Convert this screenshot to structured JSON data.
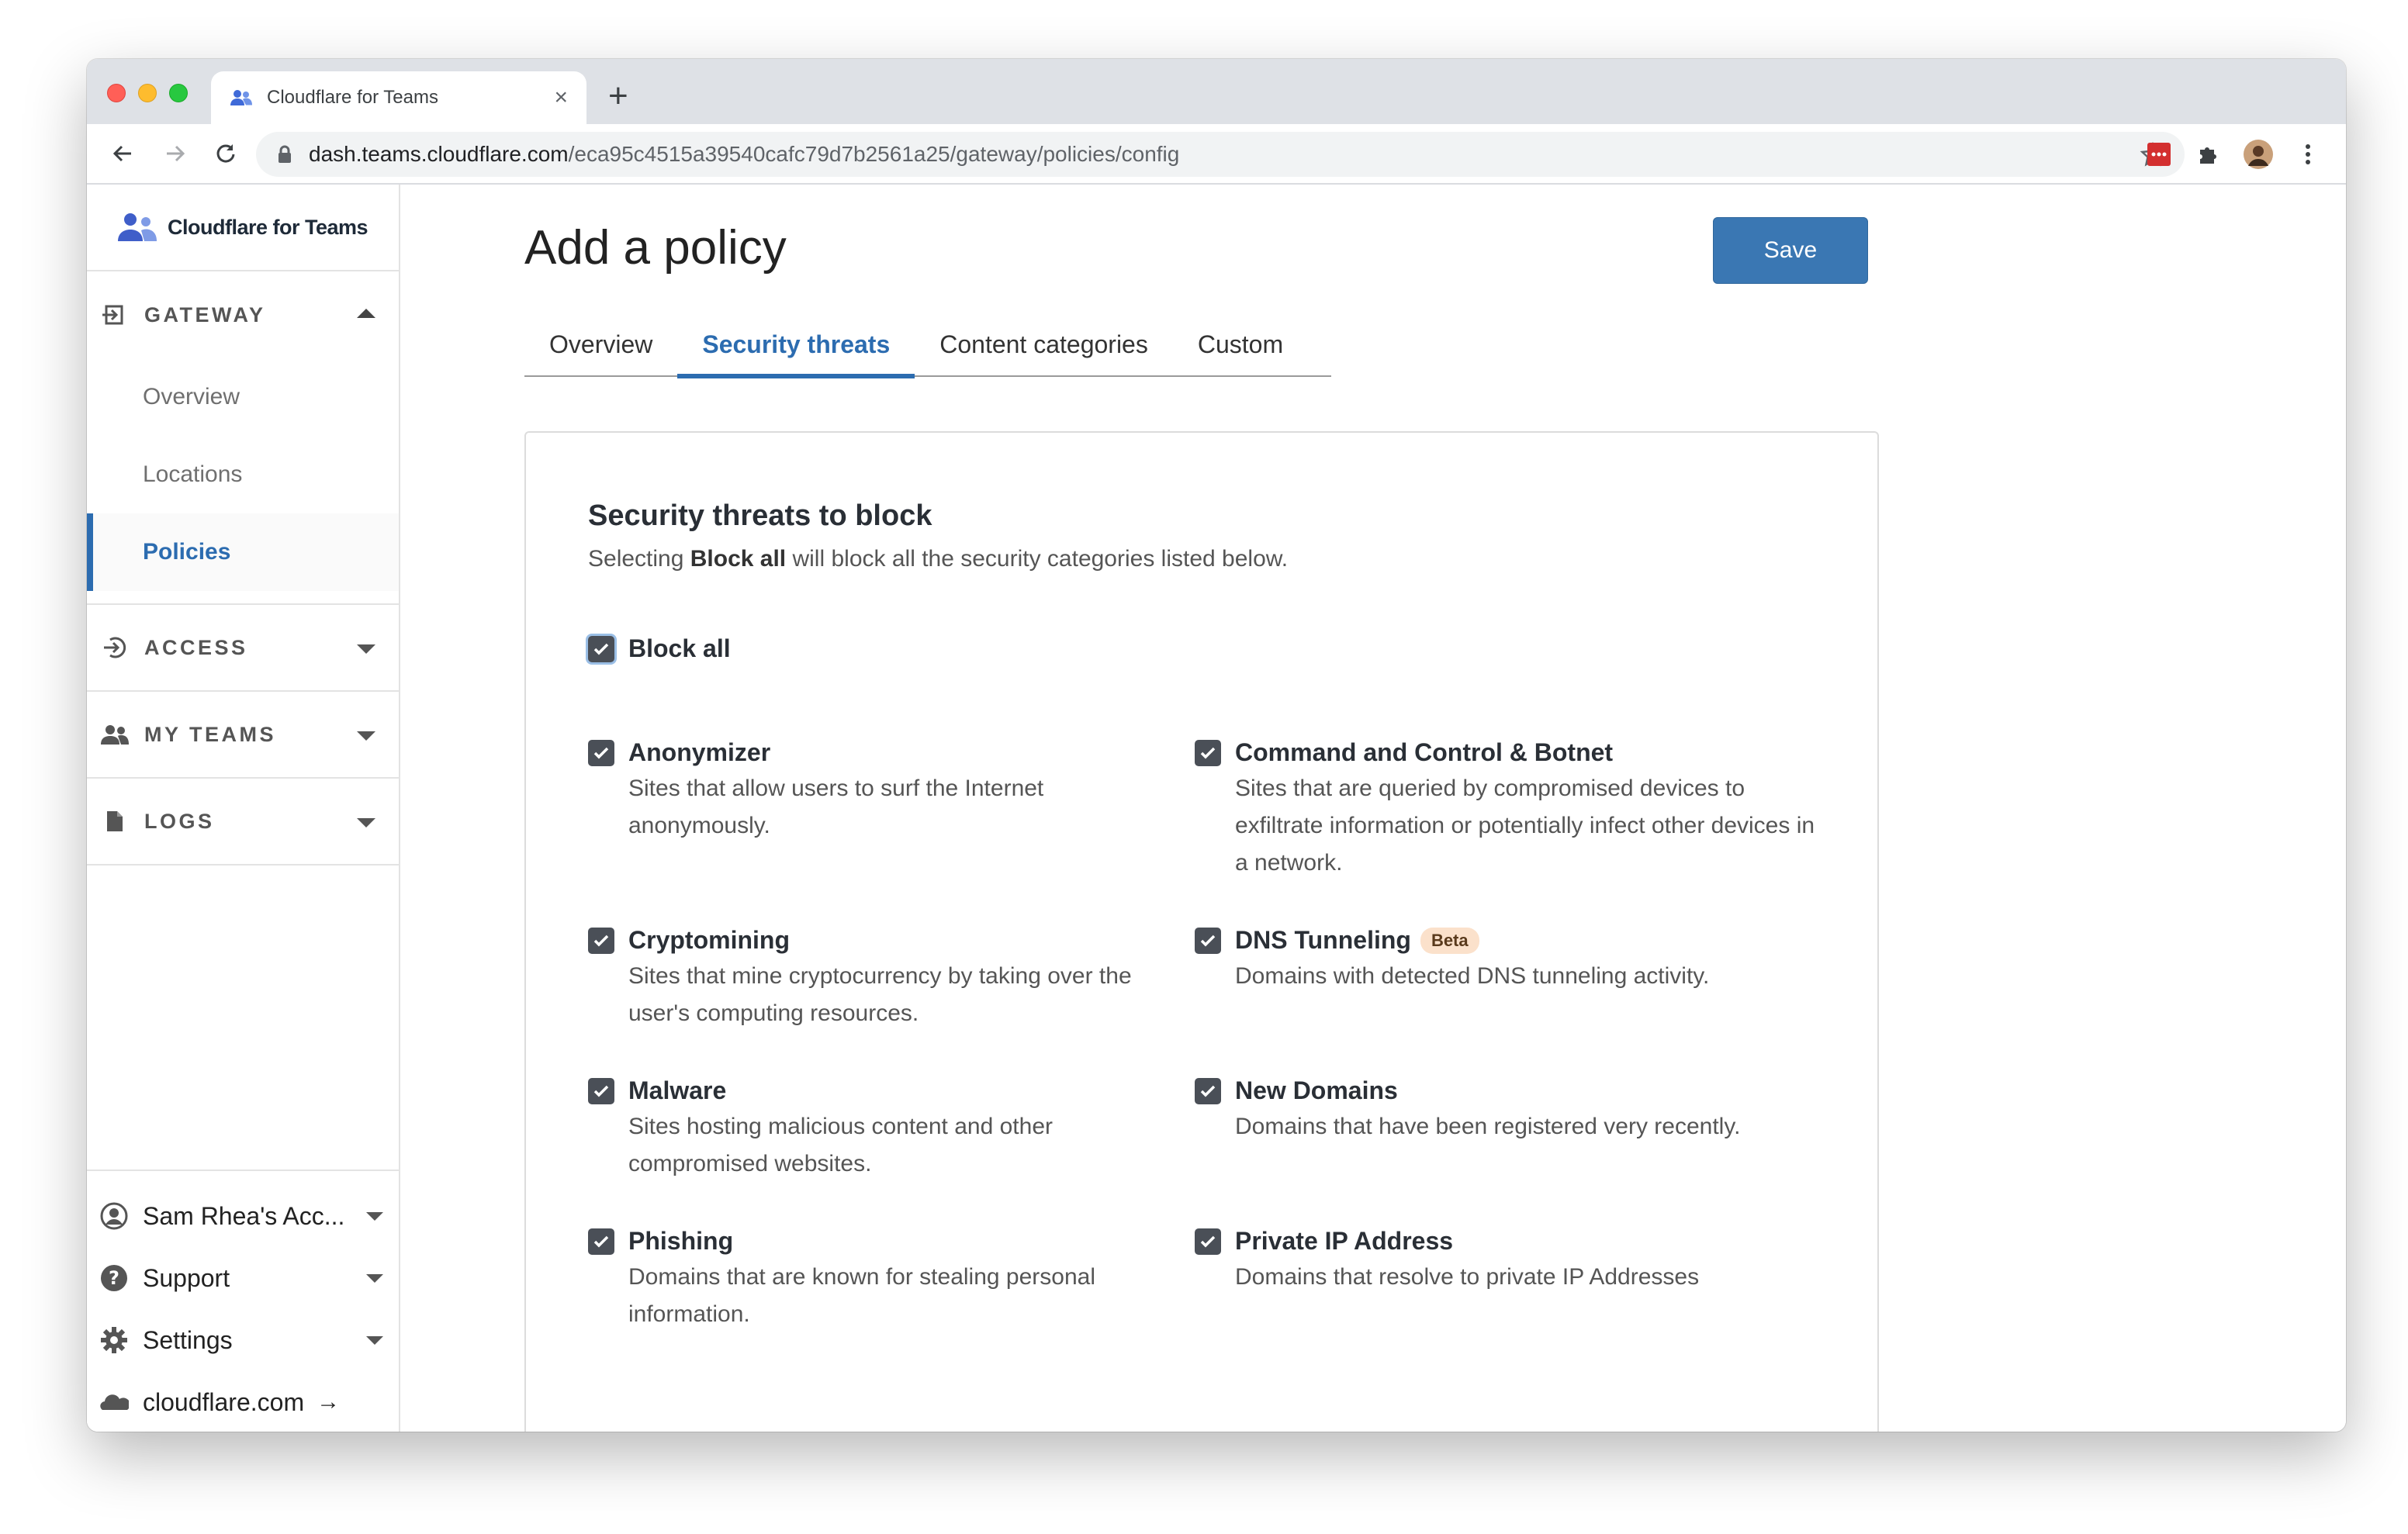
{
  "browser": {
    "tab_title": "Cloudflare for Teams",
    "url_host": "dash.teams.cloudflare.com",
    "url_path": "/eca95c4515a39540cafc79d7b2561a25/gateway/policies/config"
  },
  "sidebar": {
    "brand": "Cloudflare for Teams",
    "sections": {
      "gateway": {
        "label": "GATEWAY",
        "items": [
          "Overview",
          "Locations",
          "Policies"
        ]
      },
      "access": {
        "label": "ACCESS"
      },
      "my_teams": {
        "label": "MY TEAMS"
      },
      "logs": {
        "label": "LOGS"
      }
    },
    "bottom": {
      "account": "Sam Rhea's Acc...",
      "support": "Support",
      "settings": "Settings",
      "site": "cloudflare.com",
      "site_arrow": "→"
    }
  },
  "main": {
    "title": "Add a policy",
    "save_label": "Save",
    "tabs": [
      "Overview",
      "Security threats",
      "Content categories",
      "Custom"
    ],
    "card": {
      "title": "Security threats to block",
      "desc_prefix": "Selecting ",
      "desc_bold": "Block all",
      "desc_suffix": " will block all the security categories listed below.",
      "block_all_label": "Block all",
      "threats": [
        {
          "name": "Anonymizer",
          "desc": "Sites that allow users to surf the Internet anonymously."
        },
        {
          "name": "Command and Control & Botnet",
          "desc": "Sites that are queried by compromised devices to exfiltrate information or potentially infect other devices in a network."
        },
        {
          "name": "Cryptomining",
          "desc": "Sites that mine cryptocurrency by taking over the user's computing resources."
        },
        {
          "name": "DNS Tunneling",
          "badge": "Beta",
          "desc": "Domains with detected DNS tunneling activity."
        },
        {
          "name": "Malware",
          "desc": "Sites hosting malicious content and other compromised websites."
        },
        {
          "name": "New Domains",
          "desc": "Domains that have been registered very recently."
        },
        {
          "name": "Phishing",
          "desc": "Domains that are known for stealing personal information."
        },
        {
          "name": "Private IP Address",
          "desc": "Domains that resolve to private IP Addresses"
        }
      ]
    }
  },
  "colors": {
    "accent": "#2c6cb0",
    "save_button": "#3a77b3",
    "checkbox": "#4a4f57",
    "beta_badge": "#fbe1cb"
  },
  "icons": {
    "tab_favicon": "users-icon",
    "brand": "users-icon",
    "gateway": "gateway-icon",
    "access": "access-icon",
    "my_teams": "team-icon",
    "logs": "document-icon",
    "account": "account-icon",
    "support": "help-icon",
    "settings": "gear-icon",
    "site": "cloud-icon"
  }
}
